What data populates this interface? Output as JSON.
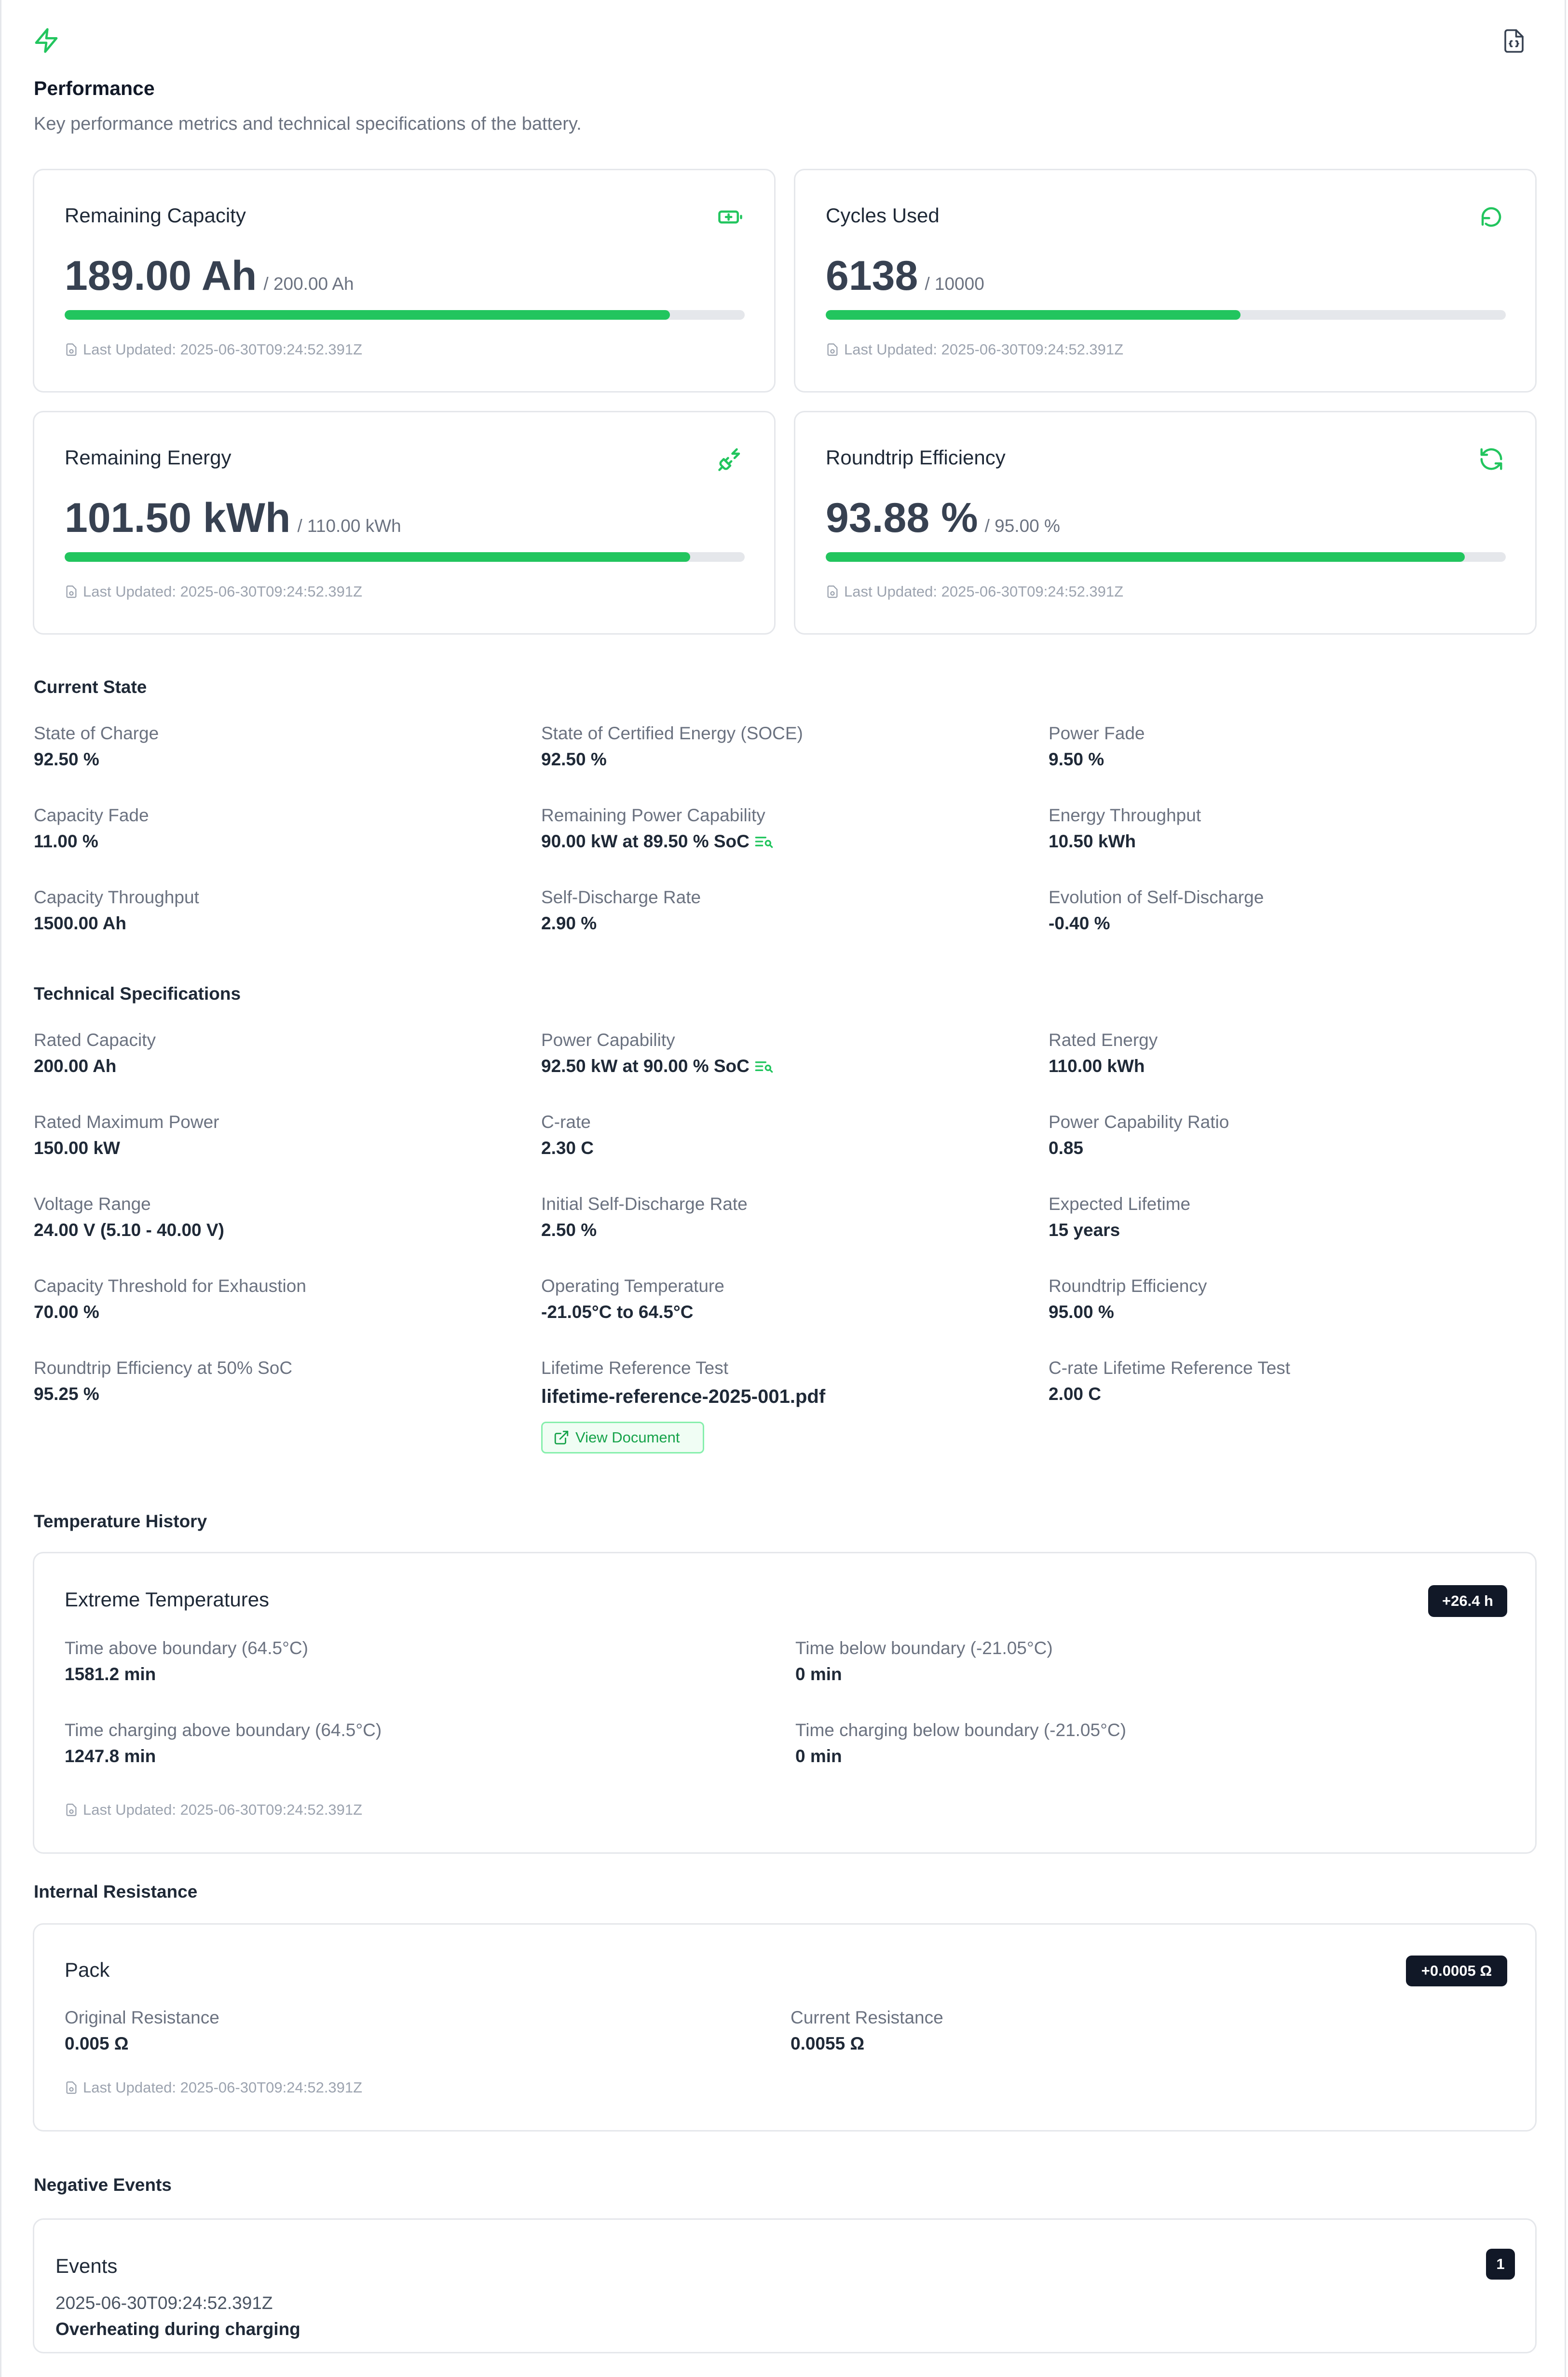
{
  "header": {
    "title": "Performance",
    "subtitle": "Key performance metrics and technical specifications of the battery.",
    "icon": "lightning-icon",
    "action_icon": "json-file-icon"
  },
  "metrics": [
    {
      "label": "Remaining Capacity",
      "value": "189.00 Ah",
      "max": "/ 200.00 Ah",
      "progress": 0.89,
      "updated": "Last Updated: 2025-06-30T09:24:52.391Z",
      "icon": "battery-plus-icon"
    },
    {
      "label": "Cycles Used",
      "value": "6138",
      "max": "/ 10000",
      "progress": 0.61,
      "updated": "Last Updated: 2025-06-30T09:24:52.391Z",
      "icon": "refresh-ccw-icon"
    },
    {
      "label": "Remaining Energy",
      "value": "101.50 kWh",
      "max": "/ 110.00 kWh",
      "progress": 0.92,
      "updated": "Last Updated: 2025-06-30T09:24:52.391Z",
      "icon": "plug-zap-icon"
    },
    {
      "label": "Roundtrip Efficiency",
      "value": "93.88 %",
      "max": "/ 95.00 %",
      "progress": 0.94,
      "updated": "Last Updated: 2025-06-30T09:24:52.391Z",
      "icon": "refresh-cw-icon"
    }
  ],
  "current_state": {
    "title": "Current State",
    "items": [
      {
        "label": "State of Charge",
        "value": "92.50 %"
      },
      {
        "label": "State of Certified Energy (SOCE)",
        "value": "92.50 %"
      },
      {
        "label": "Power Fade",
        "value": "9.50 %"
      },
      {
        "label": "Capacity Fade",
        "value": "11.00 %"
      },
      {
        "label": "Remaining Power Capability",
        "value": "90.00 kW at 89.50 % SoC"
      },
      {
        "label": "Energy Throughput",
        "value": "10.50 kWh"
      },
      {
        "label": "Capacity Throughput",
        "value": "1500.00 Ah"
      },
      {
        "label": "Self-Discharge Rate",
        "value": "2.90 %"
      },
      {
        "label": "Evolution of Self-Discharge",
        "value": "-0.40 %"
      }
    ]
  },
  "tech_specs": {
    "title": "Technical Specifications",
    "items": [
      {
        "label": "Rated Capacity",
        "value": "200.00 Ah"
      },
      {
        "label": "Power Capability",
        "value": "92.50 kW at 90.00 % SoC"
      },
      {
        "label": "Rated Energy",
        "value": "110.00 kWh"
      },
      {
        "label": "Rated Maximum Power",
        "value": "150.00 kW"
      },
      {
        "label": "C-rate",
        "value": "2.30 C"
      },
      {
        "label": "Power Capability Ratio",
        "value": "0.85"
      },
      {
        "label": "Voltage Range",
        "value": "24.00 V (5.10 - 40.00 V)"
      },
      {
        "label": "Initial Self-Discharge Rate",
        "value": "2.50 %"
      },
      {
        "label": "Expected Lifetime",
        "value": "15 years"
      },
      {
        "label": "Capacity Threshold for Exhaustion",
        "value": "70.00 %"
      },
      {
        "label": "Operating Temperature",
        "value": "-21.05°C to 64.5°C"
      },
      {
        "label": "Roundtrip Efficiency",
        "value": "95.00 %"
      },
      {
        "label": "Roundtrip Efficiency at 50% SoC",
        "value": "95.25 %"
      },
      {
        "label": "Lifetime Reference Test",
        "value": "lifetime-reference-2025-001.pdf"
      },
      {
        "label": "C-rate Lifetime Reference Test",
        "value": "2.00 C"
      }
    ],
    "view_document": "View Document"
  },
  "temperature": {
    "section": "Temperature History",
    "card_title": "Extreme Temperatures",
    "badge": "+26.4 h",
    "items": [
      {
        "label": "Time above boundary (64.5°C)",
        "value": "1581.2 min"
      },
      {
        "label": "Time below boundary (-21.05°C)",
        "value": "0 min"
      },
      {
        "label": "Time charging above boundary (64.5°C)",
        "value": "1247.8 min"
      },
      {
        "label": "Time charging below boundary (-21.05°C)",
        "value": "0 min"
      }
    ],
    "updated": "Last Updated: 2025-06-30T09:24:52.391Z"
  },
  "resistance": {
    "section": "Internal Resistance",
    "card_title": "Pack",
    "badge": "+0.0005 Ω",
    "items": [
      {
        "label": "Original Resistance",
        "value": "0.005 Ω"
      },
      {
        "label": "Current Resistance",
        "value": "0.0055 Ω"
      }
    ],
    "updated": "Last Updated: 2025-06-30T09:24:52.391Z"
  },
  "events": {
    "section": "Negative Events",
    "card_title": "Events",
    "count": "1",
    "items": [
      {
        "timestamp": "2025-06-30T09:24:52.391Z",
        "description": "Overheating during charging"
      }
    ]
  },
  "colors": {
    "accent": "#22c55e",
    "accent_dark": "#16a34a",
    "badge_bg": "#111827",
    "border": "#e5e7eb"
  }
}
